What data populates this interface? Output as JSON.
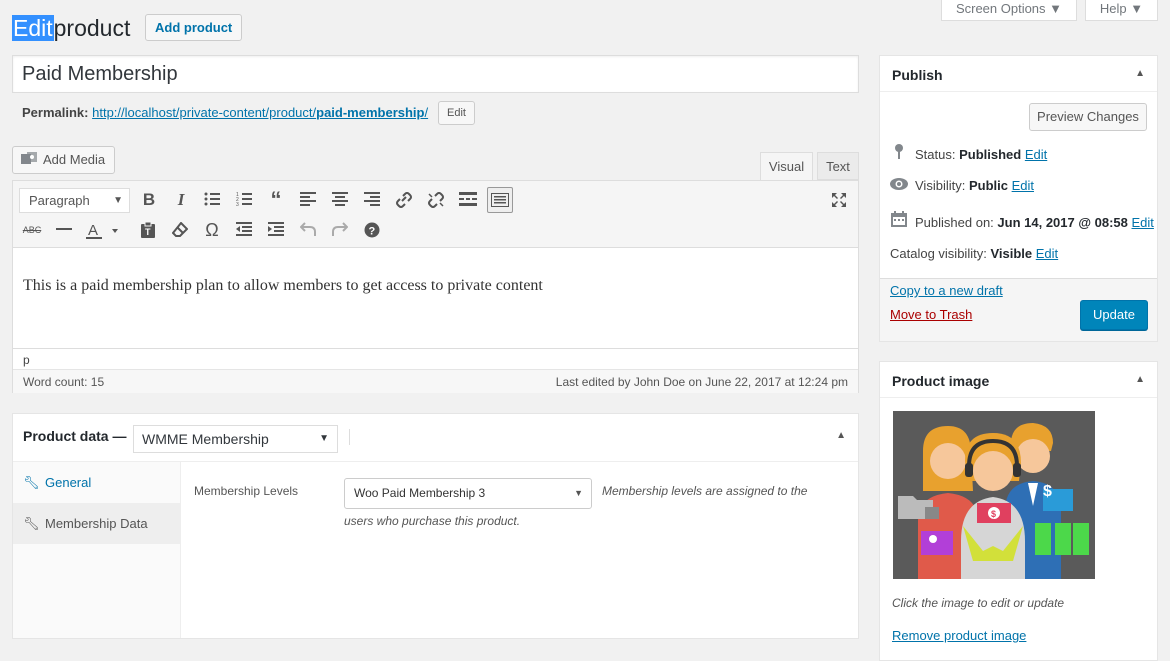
{
  "header": {
    "title_highlight": "Edit",
    "title_rest": "product",
    "add_button": "Add product",
    "screen_options": "Screen Options",
    "help": "Help"
  },
  "post": {
    "title": "Paid Membership",
    "permalink_label": "Permalink:",
    "permalink_base": "http://localhost/private-content/product/",
    "permalink_slug": "paid-membership",
    "permalink_end": "/",
    "edit_slug": "Edit"
  },
  "editor": {
    "add_media": "Add Media",
    "tab_visual": "Visual",
    "tab_text": "Text",
    "format_select": "Paragraph",
    "content": "This is a paid membership plan to allow members to get access to private content",
    "path": "p",
    "word_count": "Word count: 15",
    "last_edited": "Last edited by John Doe on June 22, 2017 at 12:24 pm"
  },
  "product_data": {
    "title": "Product data —",
    "type": "WMME Membership",
    "tabs": [
      {
        "label": "General",
        "icon": "wrench-icon"
      },
      {
        "label": "Membership Data",
        "icon": "wrench-icon"
      }
    ],
    "field_label": "Membership Levels",
    "field_value": "Woo Paid Membership 3",
    "desc_line1": "Membership levels are assigned to the",
    "desc_line2": "users who purchase this product."
  },
  "publish": {
    "title": "Publish",
    "preview": "Preview Changes",
    "status_label": "Status:",
    "status_value": "Published",
    "visibility_label": "Visibility:",
    "visibility_value": "Public",
    "published_label": "Published on:",
    "published_value": "Jun 14, 2017 @ 08:58",
    "catalog_label": "Catalog visibility:",
    "catalog_value": "Visible",
    "edit": "Edit",
    "copy_draft": "Copy to a new draft",
    "trash": "Move to Trash",
    "update": "Update"
  },
  "product_image": {
    "title": "Product image",
    "caption": "Click the image to edit or update",
    "remove": "Remove product image"
  },
  "colors": {
    "accent": "#0073aa",
    "primary_button": "#0085ba",
    "trash": "#a00000",
    "highlight": "#3390ff"
  }
}
